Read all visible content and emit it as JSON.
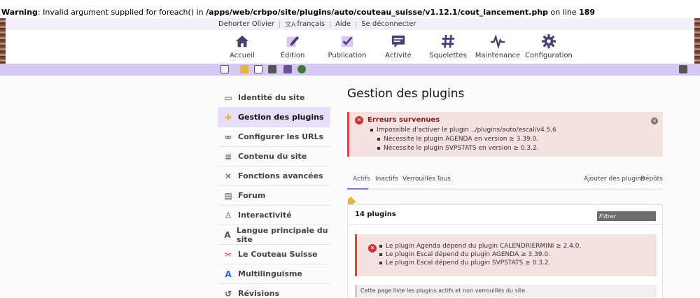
{
  "warning": {
    "label": "Warning",
    "message": ": Invalid argument supplied for foreach() in ",
    "path": "/apps/web/crbpo/site/plugins/auto/couteau_suisse/v1.12.1/cout_lancement.php",
    "on_line": " on line ",
    "line": "189"
  },
  "userbar": {
    "user": "Dehorter Olivier",
    "language": "français",
    "help": "Aide",
    "logout": "Se déconnecter"
  },
  "mainnav": [
    {
      "label": "Accueil",
      "icon": "home-icon"
    },
    {
      "label": "Édition",
      "icon": "edit-icon"
    },
    {
      "label": "Publication",
      "icon": "check-icon"
    },
    {
      "label": "Activité",
      "icon": "chat-icon"
    },
    {
      "label": "Squelettes",
      "icon": "hash-icon"
    },
    {
      "label": "Maintenance",
      "icon": "pulse-icon"
    },
    {
      "label": "Configuration",
      "icon": "gear-icon"
    }
  ],
  "sidemenu": [
    {
      "label": "Identité du site",
      "icon": "id-card-icon",
      "active": false
    },
    {
      "label": "Gestion des plugins",
      "icon": "puzzle-icon",
      "active": true
    },
    {
      "label": "Configurer les URLs",
      "icon": "link-icon",
      "active": false
    },
    {
      "label": "Contenu du site",
      "icon": "content-list-icon",
      "active": false
    },
    {
      "label": "Fonctions avancées",
      "icon": "tools-icon",
      "active": false
    },
    {
      "label": "Forum",
      "icon": "forum-icon",
      "active": false
    },
    {
      "label": "Interactivité",
      "icon": "user-gear-icon",
      "active": false
    },
    {
      "label": "Langue principale du site",
      "icon": "language-icon",
      "active": false
    },
    {
      "label": "Le Couteau Suisse",
      "icon": "knife-icon",
      "active": false
    },
    {
      "label": "Multilinguisme",
      "icon": "multilang-icon",
      "active": false
    },
    {
      "label": "Révisions",
      "icon": "history-icon",
      "active": false
    }
  ],
  "content": {
    "title": "Gestion des plugins",
    "error": {
      "title": "Erreurs survenues",
      "main": "Impossible d'activer le plugin ../plugins/auto/escal/v4.5.6",
      "sub1": "Nécessite le plugin AGENDA en version ≥ 3.39.0.",
      "sub2": "Nécessite le plugin SVPSTATS en version ≥ 0.3.2."
    },
    "tabs": {
      "actifs": "Actifs",
      "inactifs": "Inactifs",
      "verrouilles": "Verrouillés",
      "tous": "Tous",
      "ajouter": "Ajouter des plugins",
      "depots": "Dépôts"
    },
    "panel": {
      "title": "14 plugins",
      "filter_placeholder": "Filtrer",
      "deps": [
        "Le plugin Agenda dépend du plugin CALENDRIERMINI ≥ 2.4.0.",
        "Le plugin Escal dépend du plugin AGENDA ≥ 3.39.0.",
        "Le plugin Escal dépend du plugin SVPSTATS ≥ 0.3.2."
      ],
      "info": "Cette page liste les plugins actifs et non verrouillés du site."
    }
  },
  "colors": {
    "accent": "#8d6dd1",
    "toolbar": "#d7c7f3",
    "error_border": "#d9434b",
    "error_bg": "#f6e1e1"
  }
}
